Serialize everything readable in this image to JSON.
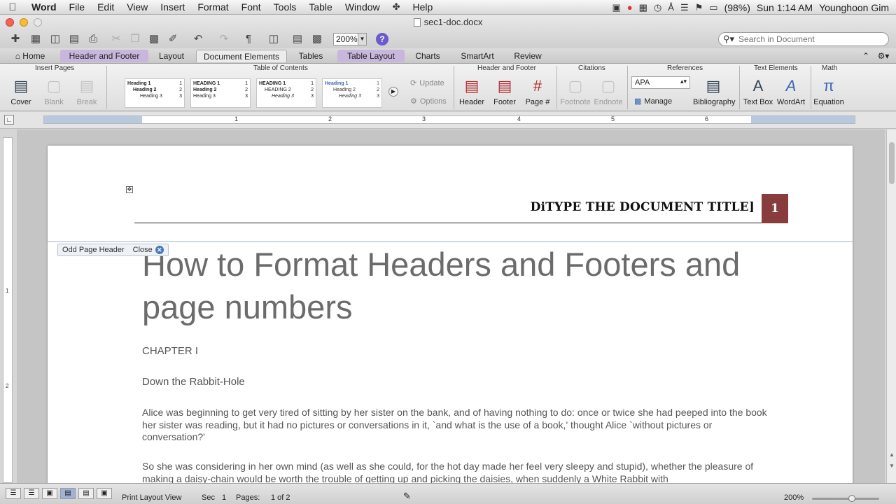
{
  "menubar": {
    "app_name": "Word",
    "items": [
      "File",
      "Edit",
      "View",
      "Insert",
      "Format",
      "Font",
      "Tools",
      "Table",
      "Window",
      "Help"
    ],
    "battery": "(98%)",
    "clock": "Sun 1:14 AM",
    "user": "Younghoon Gim"
  },
  "window": {
    "title": "sec1-doc.docx",
    "zoom": "200%",
    "search_placeholder": "Search in Document"
  },
  "ribbon_tabs": [
    "Home",
    "Header and Footer",
    "Layout",
    "Document Elements",
    "Tables",
    "Table Layout",
    "Charts",
    "SmartArt",
    "Review"
  ],
  "ribbon": {
    "groups": {
      "insert_pages": "Insert Pages",
      "toc": "Table of Contents",
      "header_footer": "Header and Footer",
      "citations": "Citations",
      "references": "References",
      "text_elements": "Text Elements",
      "math": "Math"
    },
    "buttons": {
      "cover": "Cover",
      "blank": "Blank",
      "break": "Break",
      "update": "Update",
      "options": "Options",
      "header": "Header",
      "footer": "Footer",
      "page_num": "Page #",
      "footnote": "Footnote",
      "endnote": "Endnote",
      "manage": "Manage",
      "bibliography": "Bibliography",
      "text_box": "Text Box",
      "wordart": "WordArt",
      "equation": "Equation"
    },
    "citation_style": "APA",
    "toc_previews": [
      {
        "h1": "Heading 1",
        "h2": "Heading 2",
        "h3": "Heading 3"
      },
      {
        "h1": "HEADING 1",
        "h2": "Heading 2",
        "h3": "Heading 3"
      },
      {
        "h1": "HEADING 1",
        "h2": "HEADING 2",
        "h3": "Heading 3"
      },
      {
        "h1": "Heading 1",
        "h2": "Heading 2",
        "h3": "Heading 3"
      }
    ]
  },
  "ruler": {
    "numbers": [
      "1",
      "2",
      "3",
      "4",
      "5",
      "6"
    ]
  },
  "vruler": {
    "numbers": [
      "1",
      "2"
    ]
  },
  "document": {
    "header_title": "DiTYPE THE DOCUMENT TITLE]",
    "page_number": "1",
    "header_label": "Odd Page Header",
    "close_label": "Close",
    "title": "How to Format Headers and Footers and page numbers",
    "chapter": "CHAPTER I",
    "subtitle": "Down the Rabbit-Hole",
    "para1": "Alice was beginning to get very tired of sitting by her sister on the bank, and of having nothing to do: once or twice she had peeped into the book her sister was reading, but it had no pictures or conversations in it, `and what is the use of a book,' thought Alice `without pictures or conversation?'",
    "para2": "So she was considering in her own mind (as well as she could, for the hot day made her feel very sleepy and stupid), whether the pleasure of making a daisy-chain would be worth the trouble of getting up and picking the daisies, when suddenly a White Rabbit with"
  },
  "status": {
    "view": "Print Layout View",
    "sec_label": "Sec",
    "sec_value": "1",
    "pages_label": "Pages:",
    "pages_value": "1 of 2",
    "zoom": "200%"
  },
  "colors": {
    "page_number_bg": "#893c3c",
    "purple_tab": "#c8b6dd",
    "close_button": "#4a78b8"
  }
}
